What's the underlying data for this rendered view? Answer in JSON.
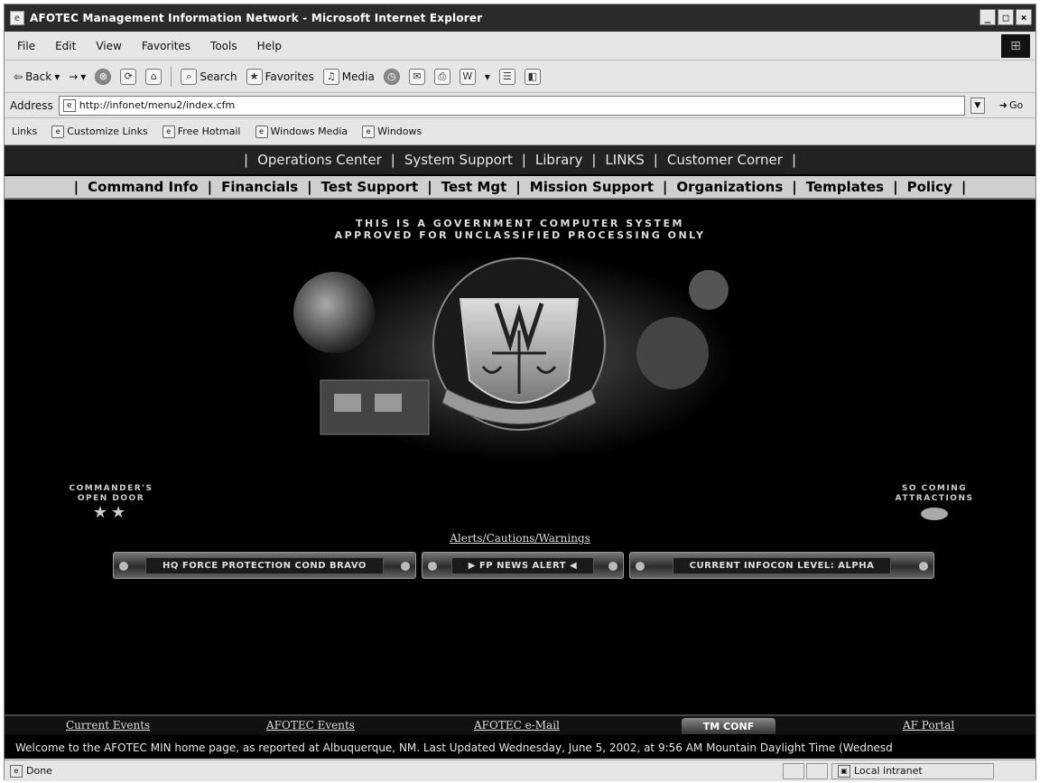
{
  "window": {
    "title": "AFOTEC Management Information Network - Microsoft Internet Explorer",
    "controls": [
      "_",
      "□",
      "×"
    ]
  },
  "menu": [
    "File",
    "Edit",
    "View",
    "Favorites",
    "Tools",
    "Help"
  ],
  "toolbar": {
    "back": "Back",
    "forward": "→",
    "stop": "⊗",
    "refresh": "⟳",
    "home": "⌂",
    "search": "Search",
    "favorites": "Favorites",
    "media": "Media",
    "history": "◷",
    "mail": "✉",
    "print": "⎙",
    "edit": "W",
    "discuss": "☰",
    "messenger": "◧"
  },
  "address": {
    "label": "Address",
    "url": "http://infonet/menu2/index.cfm",
    "go": "Go"
  },
  "links": {
    "label": "Links",
    "items": [
      "Customize Links",
      "Free Hotmail",
      "Windows Media",
      "Windows"
    ]
  },
  "page": {
    "nav_top": [
      "Operations Center",
      "System Support",
      "Library",
      "LINKS",
      "Customer Corner"
    ],
    "nav_main": [
      "Command Info",
      "Financials",
      "Test Support",
      "Test Mgt",
      "Mission Support",
      "Organizations",
      "Templates",
      "Policy"
    ],
    "warning_line1": "THIS IS A GOVERNMENT COMPUTER SYSTEM",
    "warning_line2": "APPROVED FOR UNCLASSIFIED PROCESSING ONLY",
    "commanders_line1": "COMMANDER'S",
    "commanders_line2": "OPEN DOOR",
    "commanders_stars": "★★",
    "coming_line1": "SO COMING",
    "coming_line2": "ATTRACTIONS",
    "alerts_link": "Alerts/Cautions/Warnings",
    "alert_buttons": [
      "HQ FORCE PROTECTION COND BRAVO",
      "▶ FP NEWS ALERT ◀",
      "CURRENT INFOCON LEVEL: ALPHA"
    ],
    "footer_links": [
      "Current Events",
      "AFOTEC Events",
      "AFOTEC e-Mail",
      "AF Portal"
    ],
    "footer_tab": "TM CONF",
    "ticker": "Welcome to the AFOTEC MIN home page, as reported at Albuquerque, NM.  Last Updated Wednesday, June 5, 2002, at 9:56 AM Mountain Daylight Time (Wednesd"
  },
  "status": {
    "text": "Done",
    "zone": "Local intranet"
  }
}
